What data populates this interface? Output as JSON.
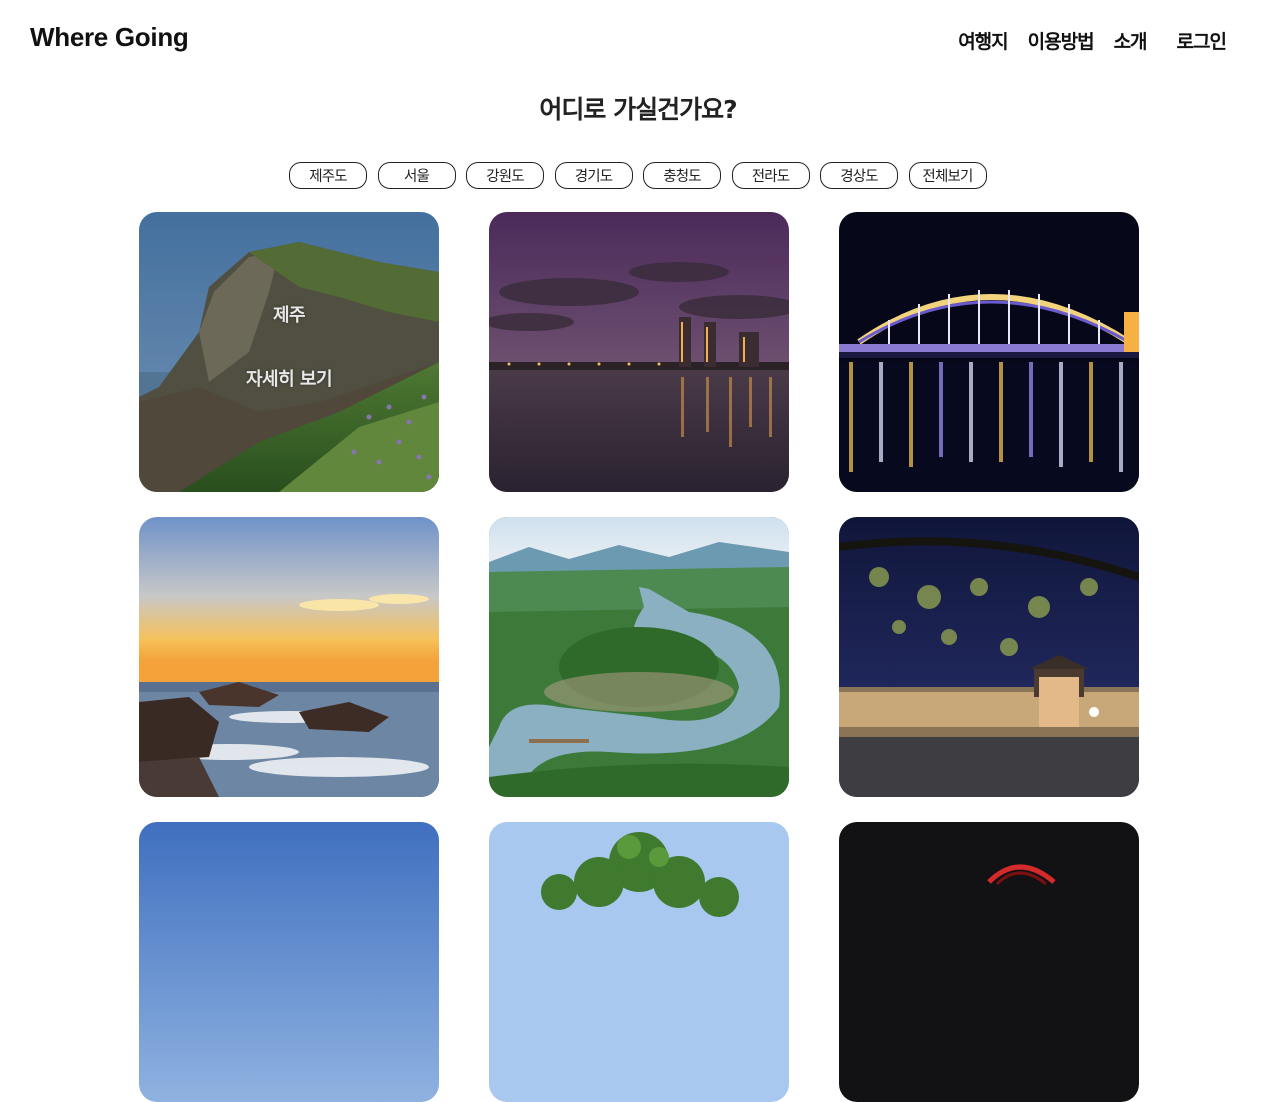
{
  "header": {
    "logo": "Where Going",
    "nav": [
      "여행지",
      "이용방법",
      "소개",
      "로그인"
    ]
  },
  "headline": "어디로 가실건가요?",
  "filters": [
    "제주도",
    "서울",
    "강원도",
    "경기도",
    "충청도",
    "전라도",
    "경상도",
    "전체보기"
  ],
  "cards": [
    {
      "scene": "jeju-cliff",
      "overlay_title": "제주",
      "overlay_more": "자세히 보기"
    },
    {
      "scene": "seoul-river-night"
    },
    {
      "scene": "lit-bridge-night"
    },
    {
      "scene": "sunset-coast"
    },
    {
      "scene": "river-bend"
    },
    {
      "scene": "fortress-night"
    },
    {
      "scene": "blue-sky"
    },
    {
      "scene": "green-tree"
    },
    {
      "scene": "dark-night-red"
    }
  ],
  "colors": {
    "text": "#111111",
    "pill_border": "#222222",
    "overlay_text": "#e8e8e8"
  }
}
